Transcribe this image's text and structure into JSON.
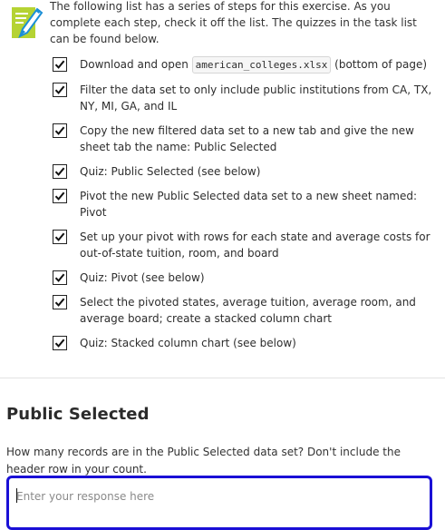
{
  "intro": {
    "icon": "checklist-pencil-icon",
    "text": "The following list has a series of steps for this exercise. As you complete each step, check it off the list. The quizzes in the task list can be found below."
  },
  "colors": {
    "icon_green": "#b5d333",
    "focus_border": "#1a10d6"
  },
  "tasks": [
    {
      "parts": [
        "Download and open ",
        "american_colleges.xlsx",
        " (bottom of page)"
      ],
      "checked": true
    },
    {
      "text": "Filter the data set to only include public institutions from CA, TX, NY, MI, GA, and IL",
      "checked": true
    },
    {
      "text": "Copy the new filtered data set to a new tab and give the new sheet tab the name: Public Selected",
      "checked": true
    },
    {
      "text": "Quiz: Public Selected (see below)",
      "checked": true
    },
    {
      "text": "Pivot the new Public Selected data set to a new sheet named: Pivot",
      "checked": true
    },
    {
      "text": "Set up your pivot with rows for each state and average costs for out-of-state tuition, room, and board",
      "checked": true
    },
    {
      "text": "Quiz: Pivot (see below)",
      "checked": true
    },
    {
      "text": "Select the pivoted states, average tuition, average room, and average board; create a stacked column chart",
      "checked": true
    },
    {
      "text": "Quiz: Stacked column chart (see below)",
      "checked": true
    }
  ],
  "section": {
    "title": "Public Selected",
    "question": "How many records are in the Public Selected data set? Don't include the header row in your count.",
    "input_placeholder": "Enter your response here",
    "input_value": ""
  }
}
